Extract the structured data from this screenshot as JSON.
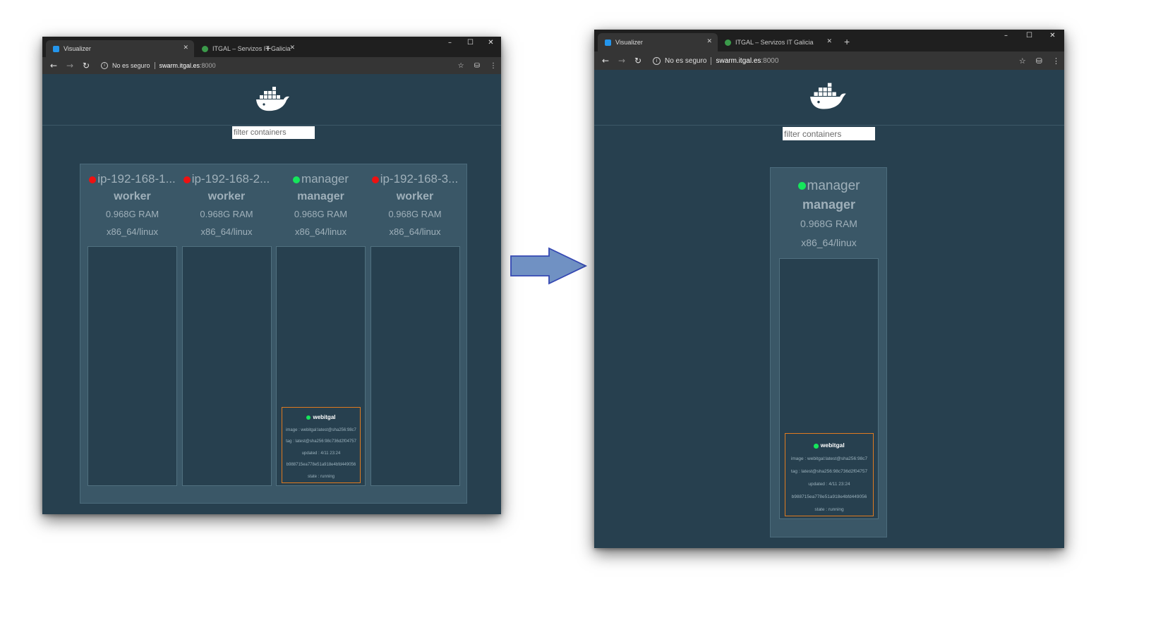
{
  "colors": {
    "content_bg": "#27404f",
    "cluster_bg": "#3a5767",
    "status_up": "#15e65b",
    "status_down": "#ee1111",
    "service_border": "#e07b1f",
    "arrow_fill": "#7091c3",
    "arrow_stroke": "#3548b3"
  },
  "browser": {
    "tabs": [
      {
        "title": "Visualizer",
        "icon": "docker-favicon-icon",
        "active": true
      },
      {
        "title": "ITGAL – Servizos IT Galicia",
        "icon": "itgal-favicon-icon",
        "active": false
      }
    ],
    "address": {
      "security": "No es seguro",
      "host": "swarm.itgal.es",
      "port": ":8000"
    }
  },
  "visualizer": {
    "filter_placeholder": "filter containers"
  },
  "before": {
    "nodes": [
      {
        "name": "ip-192-168-1...",
        "status": "down",
        "role": "worker",
        "ram": "0.968G RAM",
        "arch": "x86_64/linux"
      },
      {
        "name": "ip-192-168-2...",
        "status": "down",
        "role": "worker",
        "ram": "0.968G RAM",
        "arch": "x86_64/linux"
      },
      {
        "name": "manager",
        "status": "up",
        "role": "manager",
        "ram": "0.968G RAM",
        "arch": "x86_64/linux"
      },
      {
        "name": "ip-192-168-3...",
        "status": "down",
        "role": "worker",
        "ram": "0.968G RAM",
        "arch": "x86_64/linux"
      }
    ]
  },
  "after": {
    "nodes": [
      {
        "name": "manager",
        "status": "up",
        "role": "manager",
        "ram": "0.968G RAM",
        "arch": "x86_64/linux"
      }
    ]
  },
  "service": {
    "name": "webitgal",
    "image": "image : webitgal:latest@sha256:98c7",
    "tag": "tag : latest@sha256:98c736d2f04757",
    "updated": "updated : 4/11 23:24",
    "id": "b988715ea778e51a918e4bfd449056",
    "state": "state : running"
  }
}
